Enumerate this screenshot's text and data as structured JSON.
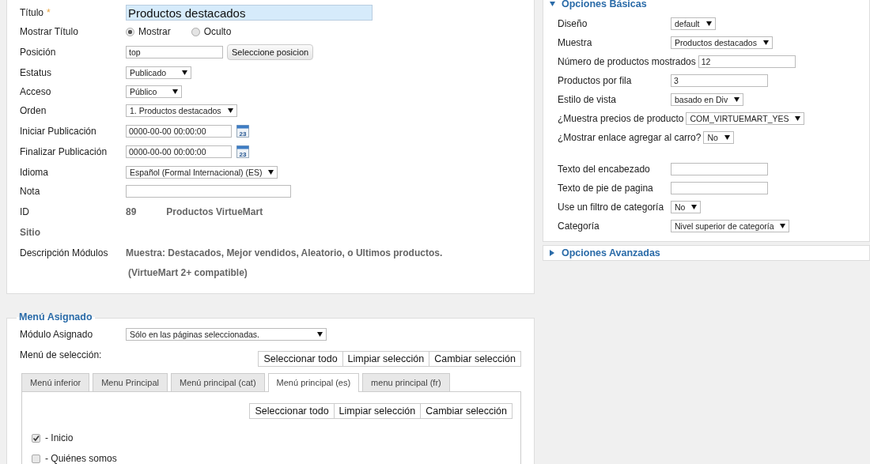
{
  "left_panel": {
    "fields": [
      {
        "kind": "title_input",
        "label": "Título",
        "required_mark": "*",
        "value": "Productos destacados"
      },
      {
        "kind": "radio",
        "label": "Mostrar Título",
        "options": [
          {
            "label": "Mostrar",
            "selected": true
          },
          {
            "label": "Oculto",
            "selected": false
          }
        ]
      },
      {
        "kind": "input_button",
        "label": "Posición",
        "value": "top",
        "button": "Seleccione posicion"
      },
      {
        "kind": "select",
        "label": "Estatus",
        "value": "Publicado"
      },
      {
        "kind": "select",
        "label": "Acceso",
        "value": "Público"
      },
      {
        "kind": "select",
        "label": "Orden",
        "value": "1. Productos destacados"
      },
      {
        "kind": "date",
        "label": "Iniciar Publicación",
        "value": "0000-00-00 00:00:00",
        "calendar_day": "23"
      },
      {
        "kind": "date",
        "label": "Finalizar Publicación",
        "value": "0000-00-00 00:00:00",
        "calendar_day": "23"
      },
      {
        "kind": "select",
        "label": "Idioma",
        "value": "Español (Formal Internacional) (ES)"
      },
      {
        "kind": "input",
        "label": "Nota"
      },
      {
        "kind": "static",
        "label": "ID",
        "values": [
          "89",
          "Productos VirtueMart"
        ]
      },
      {
        "kind": "heading",
        "label": "Sitio"
      },
      {
        "kind": "static",
        "label": "Descripción Módulos",
        "values": [
          "Muestra: Destacados, Mejor vendidos, Aleatorio, o Ultimos productos."
        ]
      }
    ],
    "note": "(VirtueMart 2+ compatible)"
  },
  "menu_assignment": {
    "legend": "Menú Asignado",
    "module_label": "Módulo Asignado",
    "module_value": "Sólo en las páginas seleccionadas.",
    "selection_label": "Menú de selección:",
    "buttons": [
      "Seleccionar todo",
      "Limpiar selección",
      "Cambiar selección"
    ],
    "tabs": [
      {
        "label": "Menú inferior",
        "selected": false
      },
      {
        "label": "Menu Principal",
        "selected": false
      },
      {
        "label": "Menú principal (cat)",
        "selected": false
      },
      {
        "label": "Menú principal (es)",
        "selected": true
      },
      {
        "label": "menu principal (fr)",
        "selected": false
      }
    ],
    "tab_buttons": [
      "Seleccionar todo",
      "Limpiar selección",
      "Cambiar selección"
    ],
    "items": [
      {
        "label": "- Inicio",
        "checked": true
      },
      {
        "label": "- Quiénes somos",
        "checked": false
      }
    ]
  },
  "right_panel": {
    "basic": {
      "title": "Opciones Básicas",
      "expanded": true,
      "groups": [
        [
          {
            "kind": "select",
            "label": "Diseño",
            "value": "default"
          },
          {
            "kind": "select",
            "label": "Muestra",
            "value": "Productos destacados"
          },
          {
            "kind": "input",
            "label": "Número de productos mostrados",
            "value": "12"
          },
          {
            "kind": "input",
            "label": "Productos por fila",
            "value": "3"
          },
          {
            "kind": "select",
            "label": "Estilo de vista",
            "value": "basado en Div"
          },
          {
            "kind": "select",
            "label": "¿Muestra precios de producto",
            "value": "COM_VIRTUEMART_YES"
          },
          {
            "kind": "select",
            "label": "¿Mostrar enlace agregar al carro?",
            "value": "No"
          }
        ],
        [
          {
            "kind": "input",
            "label": "Texto del encabezado"
          },
          {
            "kind": "input",
            "label": "Texto de pie de pagina"
          },
          {
            "kind": "select",
            "label": "Use un filtro de categoría",
            "value": "No"
          },
          {
            "kind": "select",
            "label": "Categoría",
            "value": "Nivel superior de categoría"
          }
        ]
      ]
    },
    "advanced": {
      "title": "Opciones Avanzadas",
      "expanded": false
    }
  }
}
